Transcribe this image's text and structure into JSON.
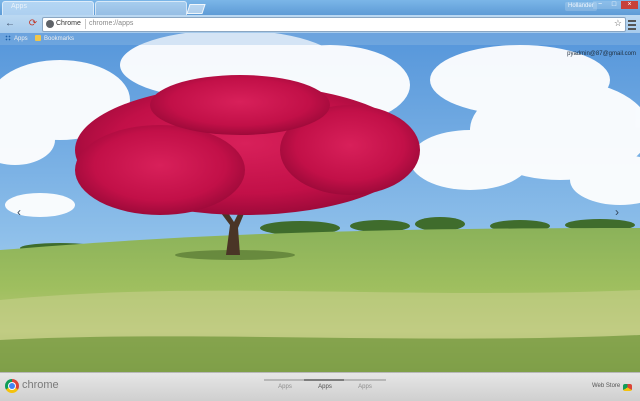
{
  "browser": {
    "tabs": [
      {
        "title": "Apps",
        "active": true
      },
      {
        "title": "",
        "active": false
      }
    ],
    "profile_name": "Hollander",
    "window_controls": {
      "minimize": "−",
      "maximize": "□",
      "close": "×"
    },
    "accent_color": "#5e9bd6"
  },
  "toolbar": {
    "back_icon": "back-arrow-icon",
    "reload_icon": "reload-icon",
    "omnibox": {
      "chip_label": "Chrome",
      "url": "chrome://apps",
      "star_icon": "star-icon"
    },
    "menu_icon": "hamburger-menu-icon"
  },
  "bookmarks": [
    {
      "label": "Apps",
      "icon": "apps-grid-icon"
    },
    {
      "label": "Bookmarks",
      "icon": "folder-icon"
    }
  ],
  "page": {
    "user_email": "pyadmin@87@gmail.com",
    "prev_icon": "chevron-left-icon",
    "next_icon": "chevron-right-icon"
  },
  "bottom_bar": {
    "brand": "chrome",
    "page_tabs": [
      {
        "label": "Apps",
        "active": false
      },
      {
        "label": "Apps",
        "active": true
      },
      {
        "label": "Apps",
        "active": false
      }
    ],
    "webstore_label": "Web Store"
  }
}
